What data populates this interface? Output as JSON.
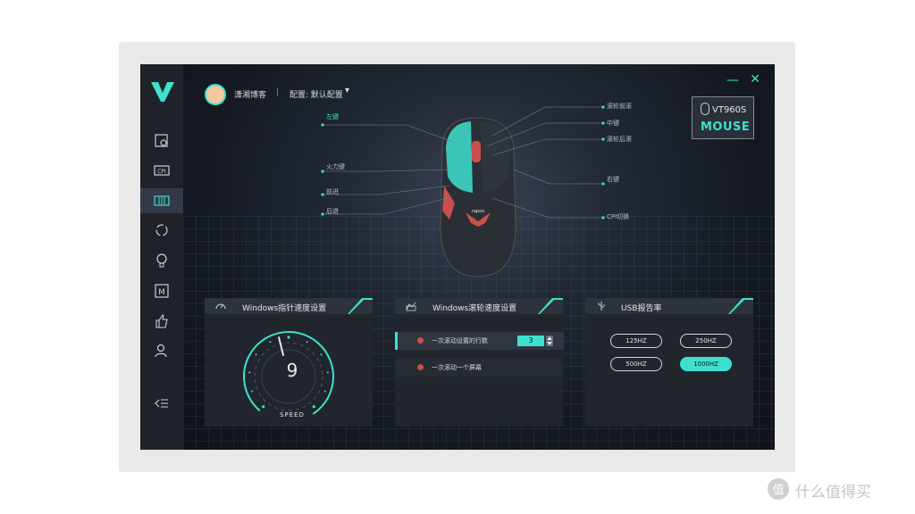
{
  "header": {
    "username": "潇湘博客",
    "separator": "|",
    "profile_label": "配置: 默认配置",
    "chevron": "▾",
    "minimize": "—",
    "close": "✕"
  },
  "sidebar": {
    "items": [
      {
        "icon": "settings-icon"
      },
      {
        "icon": "cpi-icon"
      },
      {
        "icon": "keys-icon"
      },
      {
        "icon": "refresh-icon"
      },
      {
        "icon": "bulb-icon"
      },
      {
        "icon": "macro-icon"
      },
      {
        "icon": "like-icon"
      },
      {
        "icon": "user-icon"
      }
    ],
    "collapse_icon": "collapse-icon",
    "active_index": 2
  },
  "model": {
    "name": "VT960S",
    "type": "MOUSE"
  },
  "mouse_labels": {
    "left": [
      "左键",
      "火力键",
      "前进",
      "后退"
    ],
    "right": [
      "滚轮前滚",
      "中键",
      "滚轮后滚",
      "右键",
      "CPI切换"
    ]
  },
  "cards": {
    "pointer": {
      "title": "Windows指针速度设置",
      "value": "9",
      "gauge_value": 9,
      "gauge_max": 20,
      "caption": "SPEED"
    },
    "scroll": {
      "title": "Windows滚轮速度设置",
      "options": [
        {
          "label": "一次滚动设置的行数",
          "value": "3"
        },
        {
          "label": "一次滚动一个屏幕"
        }
      ],
      "selected_index": 0
    },
    "usb": {
      "title": "USB报告率",
      "rates": [
        "125HZ",
        "250HZ",
        "500HZ",
        "1000HZ"
      ],
      "selected": "1000HZ"
    }
  },
  "watermark": "什么值得买",
  "colors": {
    "accent": "#3ee0d0",
    "panel": "#21262d",
    "sidebar": "#1f2329",
    "scroll_dot": "#c9504a"
  }
}
